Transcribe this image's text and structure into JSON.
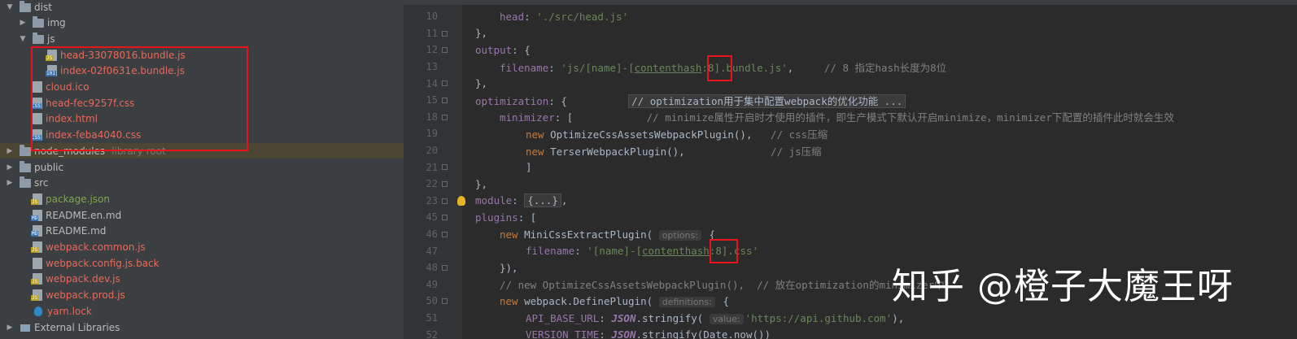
{
  "project_tree": {
    "items": [
      {
        "label": "dist",
        "kind": "folder",
        "arrow": "▼",
        "color": "default"
      },
      {
        "label": "img",
        "kind": "folder",
        "arrow": "▶",
        "color": "default"
      },
      {
        "label": "js",
        "kind": "folder",
        "arrow": "▼",
        "color": "default"
      },
      {
        "label": "head-33078016.bundle.js",
        "kind": "js",
        "arrow": "",
        "color": "red"
      },
      {
        "label": "index-02f0631e.bundle.js",
        "kind": "bin",
        "arrow": "",
        "color": "red"
      },
      {
        "label": "cloud.ico",
        "kind": "file",
        "arrow": "",
        "color": "red"
      },
      {
        "label": "head-fec9257f.css",
        "kind": "css",
        "arrow": "",
        "color": "red"
      },
      {
        "label": "index.html",
        "kind": "html",
        "arrow": "",
        "color": "red"
      },
      {
        "label": "index-feba4040.css",
        "kind": "css",
        "arrow": "",
        "color": "red"
      },
      {
        "label": "node_modules",
        "kind": "folder",
        "arrow": "▶",
        "color": "default",
        "suffix": "library root"
      },
      {
        "label": "public",
        "kind": "folder",
        "arrow": "▶",
        "color": "default"
      },
      {
        "label": "src",
        "kind": "folder",
        "arrow": "▶",
        "color": "default"
      },
      {
        "label": "package.json",
        "kind": "json",
        "arrow": "",
        "color": "green"
      },
      {
        "label": "README.en.md",
        "kind": "md",
        "arrow": "",
        "color": "default"
      },
      {
        "label": "README.md",
        "kind": "md",
        "arrow": "",
        "color": "default"
      },
      {
        "label": "webpack.common.js",
        "kind": "js",
        "arrow": "",
        "color": "red"
      },
      {
        "label": "webpack.config.js.back",
        "kind": "file",
        "arrow": "",
        "color": "red"
      },
      {
        "label": "webpack.dev.js",
        "kind": "js",
        "arrow": "",
        "color": "red"
      },
      {
        "label": "webpack.prod.js",
        "kind": "js",
        "arrow": "",
        "color": "red"
      },
      {
        "label": "yarn.lock",
        "kind": "yarn",
        "arrow": "",
        "color": "red"
      },
      {
        "label": "External Libraries",
        "kind": "libs",
        "arrow": "▶",
        "color": "default"
      }
    ]
  },
  "editor": {
    "line_numbers": [
      "10",
      "11",
      "12",
      "13",
      "14",
      "15",
      "18",
      "19",
      "20",
      "21",
      "22",
      "23",
      "45",
      "46",
      "47",
      "48",
      "49",
      "50",
      "51",
      "52"
    ],
    "lines": {
      "l10_key": "head",
      "l10_val": "'./src/head.js'",
      "l11": "},",
      "l12_key": "output",
      "l13_key": "filename",
      "l13_val_a": "'js/[name]-[",
      "l13_val_u": "contenthash",
      "l13_val_b": ":8].bundle.js'",
      "l13_comment": "// 8 指定hash长度为8位",
      "l14": "},",
      "l15_key": "optimization",
      "l15_comment": "// optimization用于集中配置webpack的优化功能 ...",
      "l18_key": "minimizer",
      "l18_comment": "// minimize属性开启时才使用的插件，即生产模式下默认开启minimize，minimizer下配置的插件此时就会生效",
      "l19_kw": "new",
      "l19_fn": "OptimizeCssAssetsWebpackPlugin",
      "l19_comment": "// css压缩",
      "l20_kw": "new",
      "l20_fn": "TerserWebpackPlugin",
      "l20_comment": "// js压缩",
      "l21": "]",
      "l22": "},",
      "l23_key": "module",
      "l23_collapsed": "{...}",
      "l45_key": "plugins",
      "l46_kw": "new",
      "l46_fn": "MiniCssExtractPlugin",
      "l46_hint": "options:",
      "l47_key": "filename",
      "l47_val_a": "'[name]-[",
      "l47_val_u": "contenthash",
      "l47_val_b": ":8].css'",
      "l48": "}),",
      "l49_comment": "// new OptimizeCssAssetsWebpackPlugin(),  // 放在optimization的minimizer中",
      "l50_kw": "new",
      "l50_obj": "webpack",
      "l50_fn": "DefinePlugin",
      "l50_hint": "definitions:",
      "l51_key": "API_BASE_URL",
      "l51_json": "JSON",
      "l51_fn": "stringify",
      "l51_hint": "value:",
      "l51_val": "'https://api.github.com'",
      "l52_key": "VERSION_TIME",
      "l52_json": "JSON",
      "l52_fn": "stringify",
      "l52_rest": "Date.now())"
    }
  },
  "watermark": {
    "text": "知乎 @橙子大魔王呀"
  },
  "colors": {
    "annotation_box": "#e8141c",
    "keyword": "#cc7832",
    "string": "#6a8759",
    "comment": "#808080",
    "property": "#9876aa"
  }
}
